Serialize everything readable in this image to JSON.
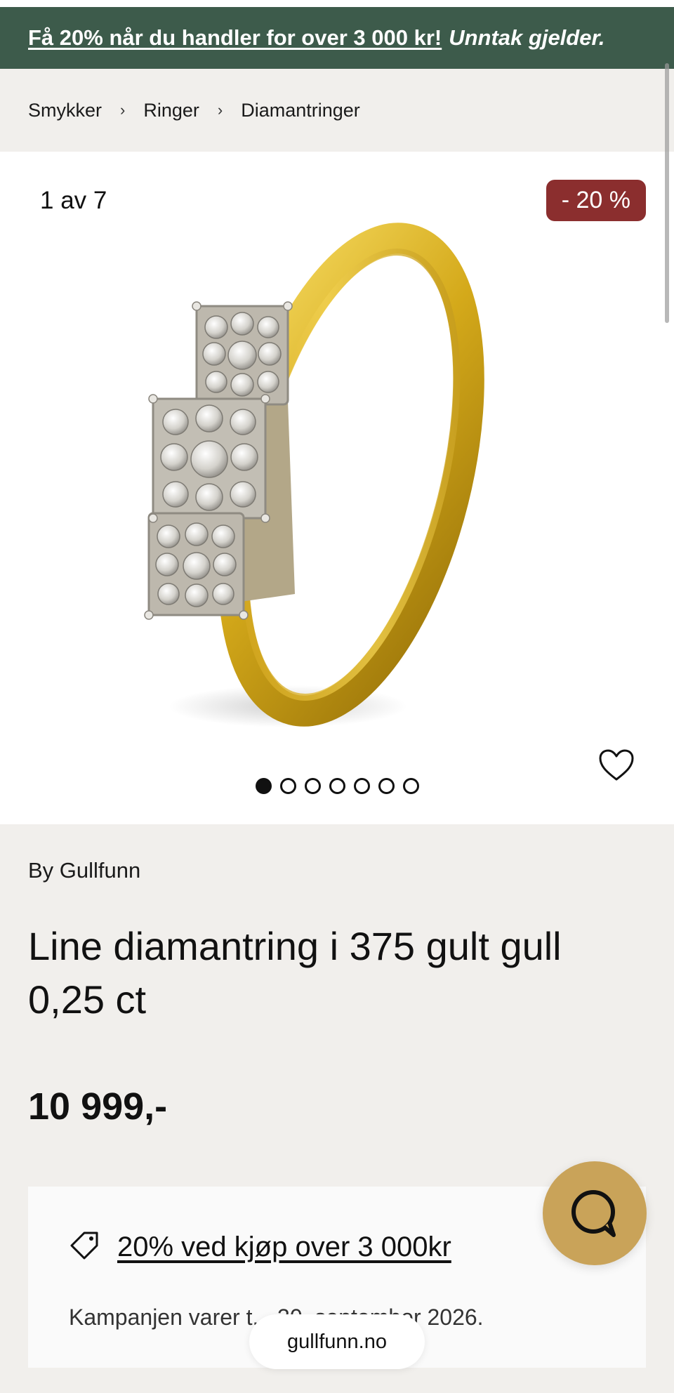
{
  "promo": {
    "link_text": "Få 20% når du handler for over 3 000 kr!",
    "note": "Unntak gjelder."
  },
  "breadcrumb": {
    "items": [
      "Smykker",
      "Ringer",
      "Diamantringer"
    ],
    "separator": "›"
  },
  "gallery": {
    "counter": "1 av 7",
    "discount_badge": "- 20 %",
    "total_images": 7,
    "active_index": 0
  },
  "product": {
    "brand": "By Gullfunn",
    "title": "Line diamantring i 375 gult gull 0,25 ct",
    "price": "10 999,-"
  },
  "offer": {
    "link_text": "20% ved kjøp over 3 000kr",
    "period": "Kampanjen varer t... 30. september 2026."
  },
  "browser": {
    "url": "gullfunn.no"
  },
  "icons": {
    "favorite": "heart-icon",
    "offer": "tag-icon",
    "chat": "chat-bubble-icon"
  },
  "colors": {
    "promo_bg": "#3d5b4b",
    "discount_bg": "#8b2e2e",
    "chat_bg": "#c9a359",
    "page_bg": "#f1efec"
  }
}
